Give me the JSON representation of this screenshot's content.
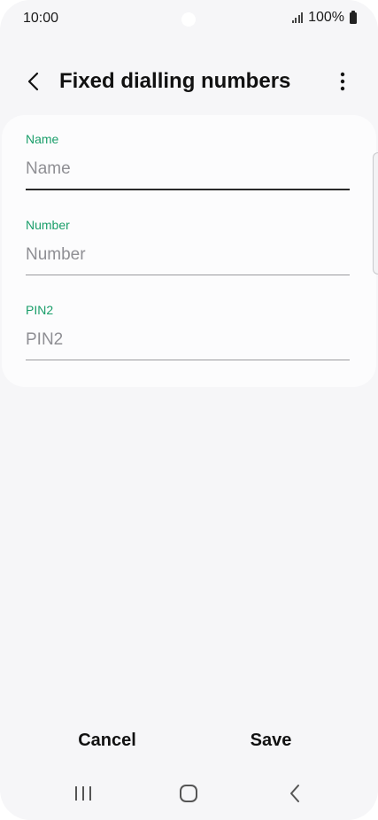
{
  "status_bar": {
    "time": "10:00",
    "battery_text": "100%",
    "icons": [
      "signal-icon",
      "battery-icon"
    ]
  },
  "app_bar": {
    "title": "Fixed dialling numbers",
    "back_icon": "chevron-left-icon",
    "more_icon": "more-vertical-icon"
  },
  "form": {
    "fields": [
      {
        "label": "Name",
        "placeholder": "Name",
        "value": "",
        "active": true
      },
      {
        "label": "Number",
        "placeholder": "Number",
        "value": "",
        "active": false
      },
      {
        "label": "PIN2",
        "placeholder": "PIN2",
        "value": "",
        "active": false
      }
    ]
  },
  "actions": {
    "cancel_label": "Cancel",
    "save_label": "Save"
  },
  "nav_bar": {
    "icons": [
      "recents-icon",
      "home-icon",
      "back-icon"
    ]
  },
  "colors": {
    "label_accent": "#1a9e6a",
    "background": "#f6f6f8",
    "card": "#fcfcfd"
  }
}
